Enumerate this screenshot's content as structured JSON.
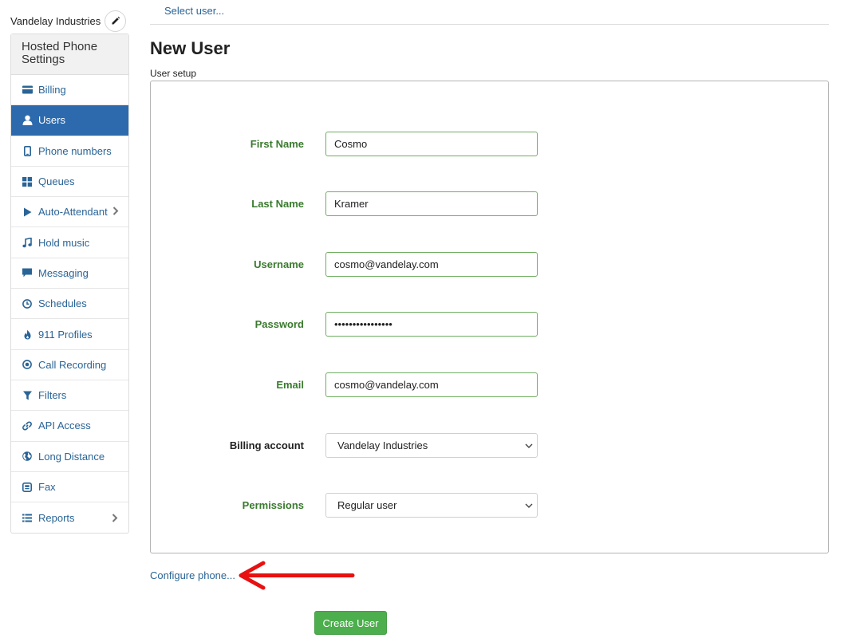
{
  "company": {
    "name": "Vandelay Industries",
    "edit_icon": "pencil-icon"
  },
  "sidebar": {
    "heading": "Hosted Phone Settings",
    "items": [
      {
        "label": "Billing",
        "icon": "credit-card-icon"
      },
      {
        "label": "Users",
        "icon": "user-icon",
        "active": true
      },
      {
        "label": "Phone numbers",
        "icon": "mobile-phone-icon"
      },
      {
        "label": "Queues",
        "icon": "grid-icon"
      },
      {
        "label": "Auto-Attendant",
        "icon": "play-icon"
      },
      {
        "label": "Hold music",
        "icon": "music-note-icon"
      },
      {
        "label": "Messaging",
        "icon": "speech-bubble-icon"
      },
      {
        "label": "Schedules",
        "icon": "clock-icon"
      },
      {
        "label": "911 Profiles",
        "icon": "fire-icon"
      },
      {
        "label": "Call Recording",
        "icon": "record-icon"
      },
      {
        "label": "Filters",
        "icon": "filter-icon"
      },
      {
        "label": "API Access",
        "icon": "link-icon"
      },
      {
        "label": "Long Distance",
        "icon": "globe-icon"
      },
      {
        "label": "Fax",
        "icon": "fax-icon"
      },
      {
        "label": "Reports",
        "icon": "list-icon"
      }
    ]
  },
  "header": {
    "select_user": "Select user...",
    "title": "New User",
    "section": "User setup"
  },
  "form": {
    "first_name": {
      "label": "First Name",
      "value": "Cosmo"
    },
    "last_name": {
      "label": "Last Name",
      "value": "Kramer"
    },
    "username": {
      "label": "Username",
      "value": "cosmo@vandelay.com"
    },
    "password": {
      "label": "Password",
      "value": "••••••••••••••••"
    },
    "email": {
      "label": "Email",
      "value": "cosmo@vandelay.com"
    },
    "billing_account": {
      "label": "Billing account",
      "value": "Vandelay Industries"
    },
    "permissions": {
      "label": "Permissions",
      "value": "Regular user"
    }
  },
  "actions": {
    "configure_phone": "Configure phone...",
    "create_user": "Create User"
  },
  "colors": {
    "link": "#2a6496",
    "active_nav": "#2d6aad",
    "label_green": "#3a7a2e",
    "input_border": "#6fae62",
    "create_button": "#4cae4c",
    "annotation_arrow": "#e81010"
  }
}
